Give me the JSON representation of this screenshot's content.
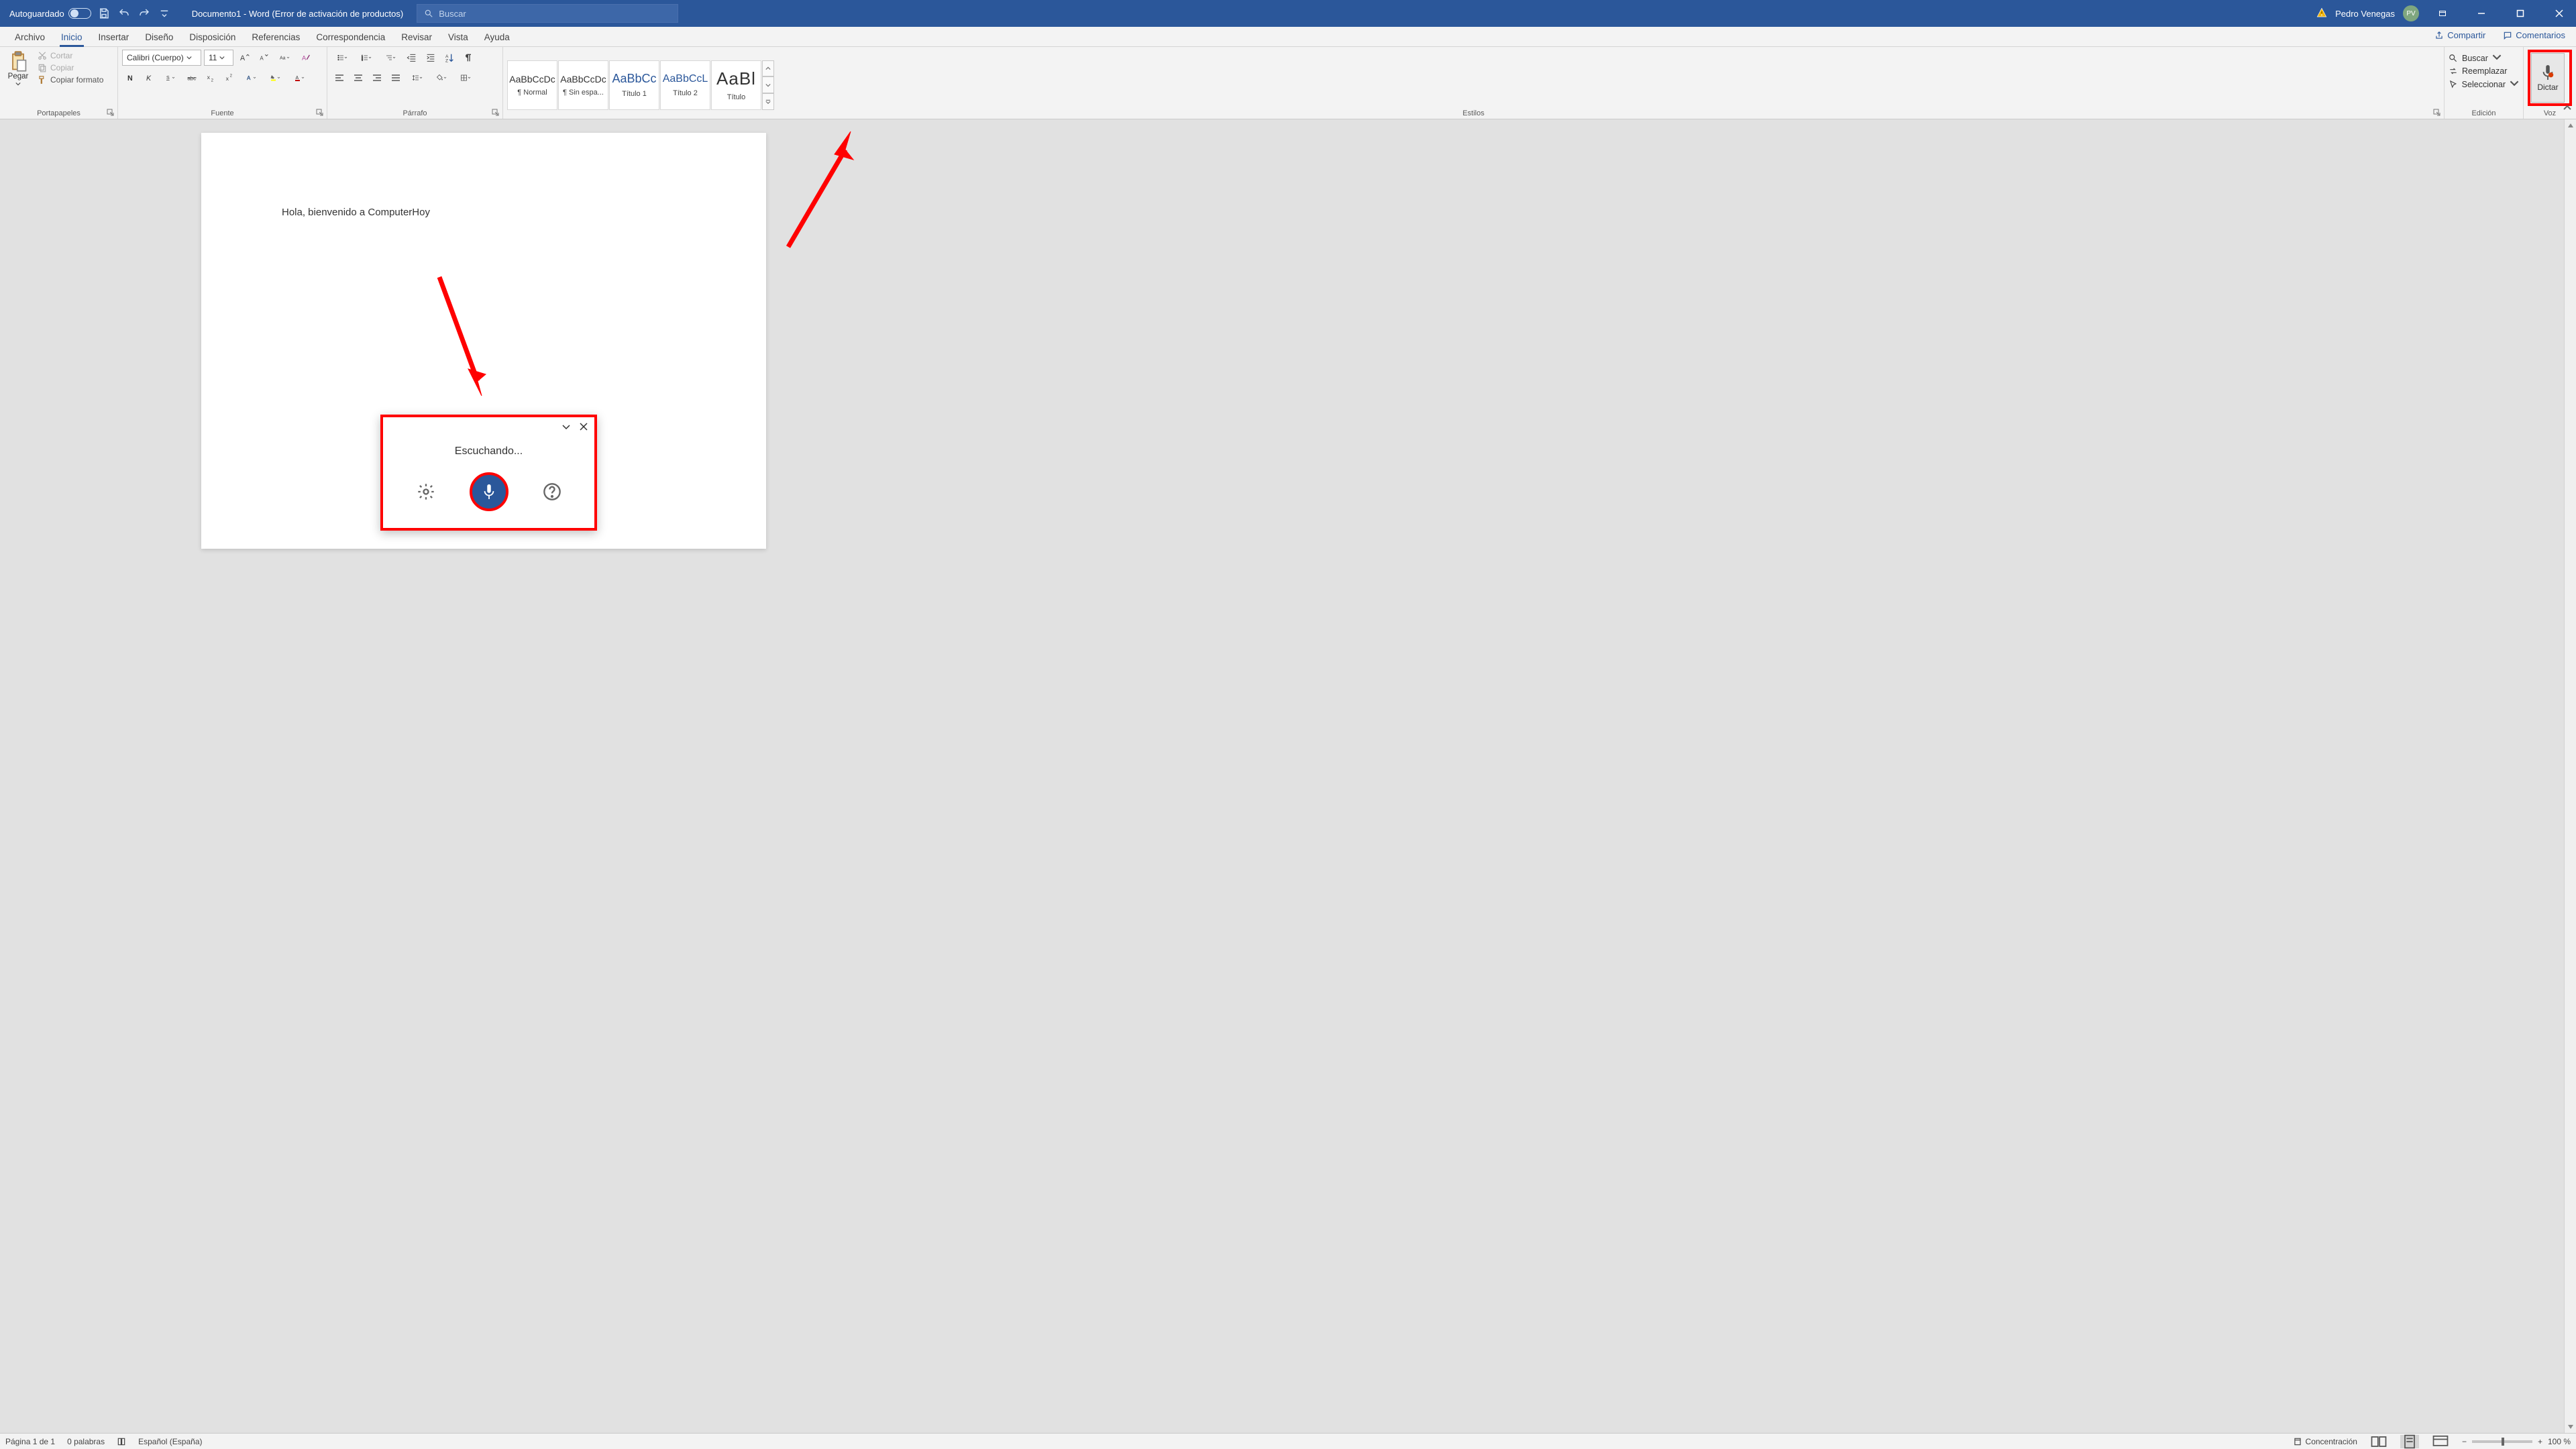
{
  "titlebar": {
    "autosave_label": "Autoguardado",
    "doc_title": "Documento1 - Word (Error de activación de productos)",
    "search_placeholder": "Buscar",
    "user_name": "Pedro Venegas",
    "user_initials": "PV"
  },
  "tabs": {
    "items": [
      "Archivo",
      "Inicio",
      "Insertar",
      "Diseño",
      "Disposición",
      "Referencias",
      "Correspondencia",
      "Revisar",
      "Vista",
      "Ayuda"
    ],
    "active_index": 1,
    "share_label": "Compartir",
    "comments_label": "Comentarios"
  },
  "ribbon": {
    "clipboard": {
      "paste": "Pegar",
      "cut": "Cortar",
      "copy": "Copiar",
      "format_painter": "Copiar formato",
      "group_label": "Portapapeles"
    },
    "font": {
      "family": "Calibri (Cuerpo)",
      "size": "11",
      "group_label": "Fuente"
    },
    "paragraph": {
      "group_label": "Párrafo"
    },
    "styles": {
      "items": [
        {
          "preview": "AaBbCcDc",
          "label": "¶ Normal"
        },
        {
          "preview": "AaBbCcDc",
          "label": "¶ Sin espa..."
        },
        {
          "preview": "AaBbCc",
          "label": "Título 1"
        },
        {
          "preview": "AaBbCcL",
          "label": "Título 2"
        },
        {
          "preview": "AaBl",
          "label": "Título"
        }
      ],
      "group_label": "Estilos"
    },
    "editing": {
      "find": "Buscar",
      "replace": "Reemplazar",
      "select": "Seleccionar",
      "group_label": "Edición"
    },
    "voice": {
      "dictate": "Dictar",
      "group_label": "Voz"
    }
  },
  "document": {
    "body_text": "Hola, bienvenido a ComputerHoy"
  },
  "dictation": {
    "status": "Escuchando..."
  },
  "statusbar": {
    "page": "Página 1 de 1",
    "words": "0 palabras",
    "language": "Español (España)",
    "focus_mode": "Concentración",
    "zoom": "100 %"
  }
}
